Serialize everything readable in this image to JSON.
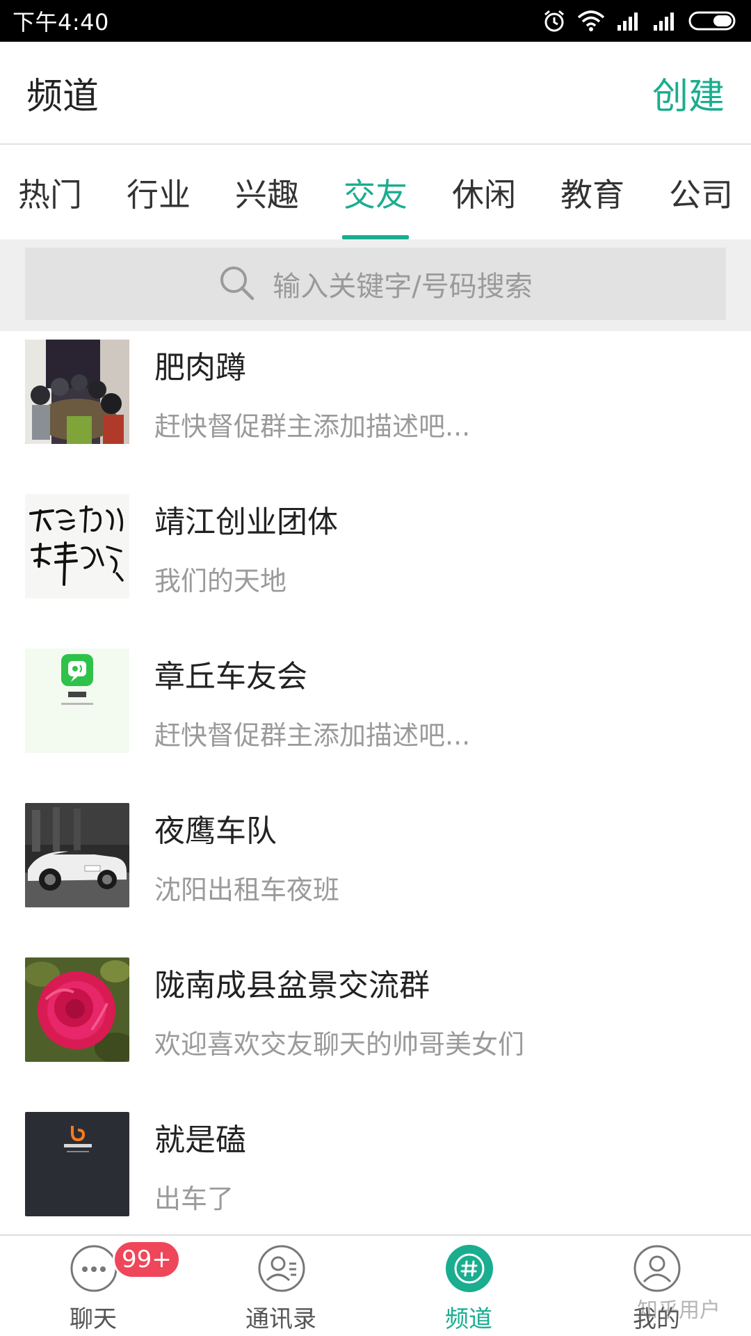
{
  "status_bar": {
    "time": "下午4:40"
  },
  "header": {
    "title": "频道",
    "create_label": "创建"
  },
  "tabs": [
    {
      "label": "热门",
      "active": false
    },
    {
      "label": "行业",
      "active": false
    },
    {
      "label": "兴趣",
      "active": false
    },
    {
      "label": "交友",
      "active": true
    },
    {
      "label": "休闲",
      "active": false
    },
    {
      "label": "教育",
      "active": false
    },
    {
      "label": "公司",
      "active": false
    }
  ],
  "search": {
    "placeholder": "输入关键字/号码搜索"
  },
  "channels": [
    {
      "name": "肥肉蹲",
      "description": "赶快督促群主添加描述吧...",
      "avatar": "group-photo-avatar"
    },
    {
      "name": "靖江创业团体",
      "description": "我们的天地",
      "avatar": "calligraphy-avatar"
    },
    {
      "name": "章丘车友会",
      "description": "赶快督促群主添加描述吧...",
      "avatar": "weila-app-avatar"
    },
    {
      "name": "夜鹰车队",
      "description": "沈阳出租车夜班",
      "avatar": "sports-car-avatar"
    },
    {
      "name": "陇南成县盆景交流群",
      "description": "欢迎喜欢交友聊天的帅哥美女们",
      "avatar": "flower-avatar"
    },
    {
      "name": "就是磕",
      "description": "出车了",
      "avatar": "didi-logo-avatar"
    }
  ],
  "bottom_nav": {
    "chat": {
      "label": "聊天",
      "badge": "99+"
    },
    "contacts": {
      "label": "通讯录"
    },
    "channels": {
      "label": "频道",
      "active": true
    },
    "me": {
      "label": "我的"
    }
  },
  "watermark": "知乎用户",
  "colors": {
    "accent": "#1aad8f",
    "badge": "#f0465a",
    "status_bar": "#000000"
  }
}
